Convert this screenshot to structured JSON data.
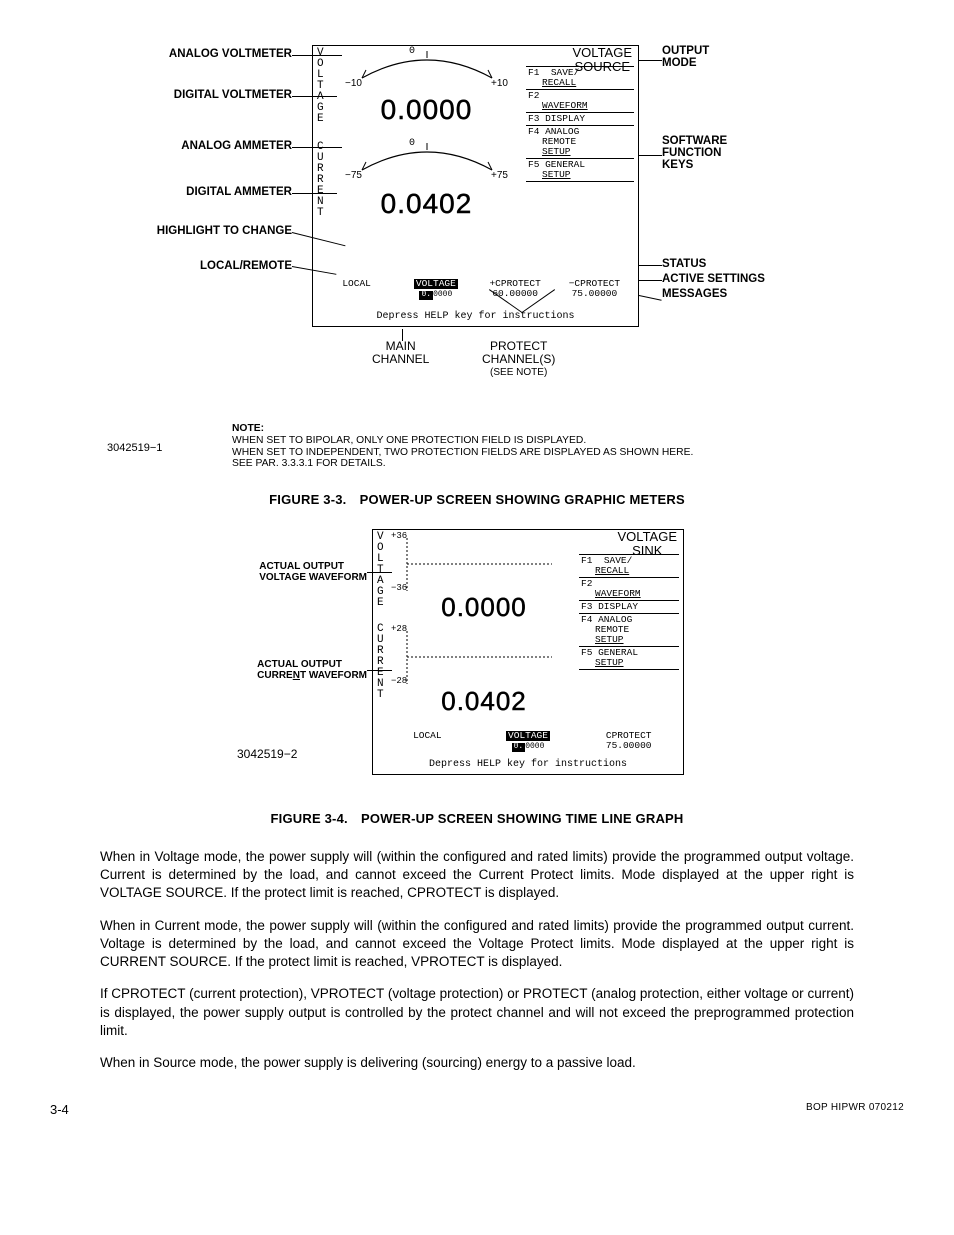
{
  "fig33": {
    "left_labels": {
      "analog_voltmeter": "ANALOG VOLTMETER",
      "digital_voltmeter": "DIGITAL VOLTMETER",
      "analog_ammeter": "ANALOG AMMETER",
      "digital_ammeter": "DIGITAL AMMETER",
      "highlight": "HIGHLIGHT TO CHANGE",
      "local_remote": "LOCAL/REMOTE"
    },
    "right_labels": {
      "voltage_source": "VOLTAGE\nSOURCE",
      "output_mode": "OUTPUT\nMODE",
      "software_keys": "SOFTWARE\nFUNCTION\nKEYS",
      "status": "STATUS",
      "active_settings": "ACTIVE SETTINGS",
      "messages": "MESSAGES"
    },
    "bottom_callouts": {
      "main_channel": "MAIN\nCHANNEL",
      "protect_channels": "PROTECT\nCHANNEL(S)\n(SEE NOTE)"
    },
    "screen": {
      "vlabel_voltage": "VOLTAGE",
      "vlabel_current": "CURRENT",
      "header": "VOLTAGE\nSOURCE",
      "volt_min": "−10",
      "volt_zero": "0",
      "volt_max": "+10",
      "volt_digital": "0.0000",
      "curr_min": "−75",
      "curr_zero": "0",
      "curr_max": "+75",
      "curr_digital": "0.0402",
      "fkeys": [
        {
          "k": "F1",
          "l1": "SAVE/",
          "l2": "RECALL"
        },
        {
          "k": "F2",
          "l1": "",
          "l2": "WAVEFORM"
        },
        {
          "k": "F3",
          "l1": "DISPLAY",
          "l2": ""
        },
        {
          "k": "F4",
          "l1": "ANALOG",
          "l2": "REMOTE",
          "l3": "SETUP"
        },
        {
          "k": "F5",
          "l1": "GENERAL",
          "l2": "SETUP"
        }
      ],
      "status": {
        "local": "LOCAL",
        "main_label": "VOLTAGE",
        "main_value": "0.0000",
        "cprotect_pos": "+CPROTECT",
        "cprotect_pos_val": "60.00000",
        "cprotect_neg": "−CPROTECT",
        "cprotect_neg_val": "75.00000"
      },
      "message": "Depress HELP key for instructions"
    },
    "note_title": "NOTE:",
    "note_line1": "WHEN SET TO BIPOLAR, ONLY ONE PROTECTION FIELD IS DISPLAYED.",
    "note_line2": "WHEN SET TO INDEPENDENT, TWO PROTECTION FIELDS ARE DISPLAYED AS SHOWN HERE.",
    "note_line3": "SEE PAR. 3.3.3.1 FOR DETAILS.",
    "drawing_number": "3042519−1",
    "caption": "FIGURE 3-3. POWER-UP SCREEN SHOWING GRAPHIC METERS"
  },
  "fig34": {
    "left_labels": {
      "voltage_waveform": "ACTUAL OUTPUT\nVOLTAGE WAVEFORM",
      "current_waveform": "ACTUAL OUTPUT\nCURRENT WAVEFORM"
    },
    "screen": {
      "vlabel_voltage": "VOLTAGE",
      "vlabel_current": "CURRENT",
      "header": "VOLTAGE\nSINK",
      "volt_max": "+36",
      "volt_min": "−36",
      "volt_digital": "0.0000",
      "curr_max": "+28",
      "curr_min": "−28",
      "curr_digital": "0.0402",
      "fkeys": [
        {
          "k": "F1",
          "l1": "SAVE/",
          "l2": "RECALL"
        },
        {
          "k": "F2",
          "l1": "",
          "l2": "WAVEFORM"
        },
        {
          "k": "F3",
          "l1": "DISPLAY",
          "l2": ""
        },
        {
          "k": "F4",
          "l1": "ANALOG",
          "l2": "REMOTE",
          "l3": "SETUP"
        },
        {
          "k": "F5",
          "l1": "GENERAL",
          "l2": "SETUP"
        }
      ],
      "status": {
        "local": "LOCAL",
        "main_label": "VOLTAGE",
        "main_value": "0.0000",
        "cprotect": "CPROTECT",
        "cprotect_val": "75.00000"
      },
      "message": "Depress HELP key for instructions"
    },
    "drawing_number": "3042519−2",
    "caption": "FIGURE 3-4. POWER-UP SCREEN SHOWING TIME LINE GRAPH"
  },
  "paragraphs": {
    "p1": "When in Voltage mode, the power supply will (within the configured and rated limits) provide the programmed output voltage. Current is determined by the load, and cannot exceed the Current Protect limits. Mode displayed at the upper right is VOLTAGE SOURCE. If the protect limit is reached, CPROTECT is displayed.",
    "p2": "When in Current mode, the power supply will (within the configured and rated limits) provide the programmed output current. Voltage is determined by the load, and cannot exceed the Voltage Protect limits. Mode displayed at the upper right is CURRENT SOURCE. If the protect limit is reached, VPROTECT is displayed.",
    "p3": "If CPROTECT (current protection), VPROTECT (voltage protection) or PROTECT (analog protection, either voltage or current) is displayed, the power supply output is controlled by the protect channel and will not exceed the preprogrammed protection limit.",
    "p4": "When in Source mode, the power supply is delivering (sourcing) energy to a passive load."
  },
  "footer": {
    "page": "3-4",
    "doc": "BOP HIPWR 070212"
  }
}
